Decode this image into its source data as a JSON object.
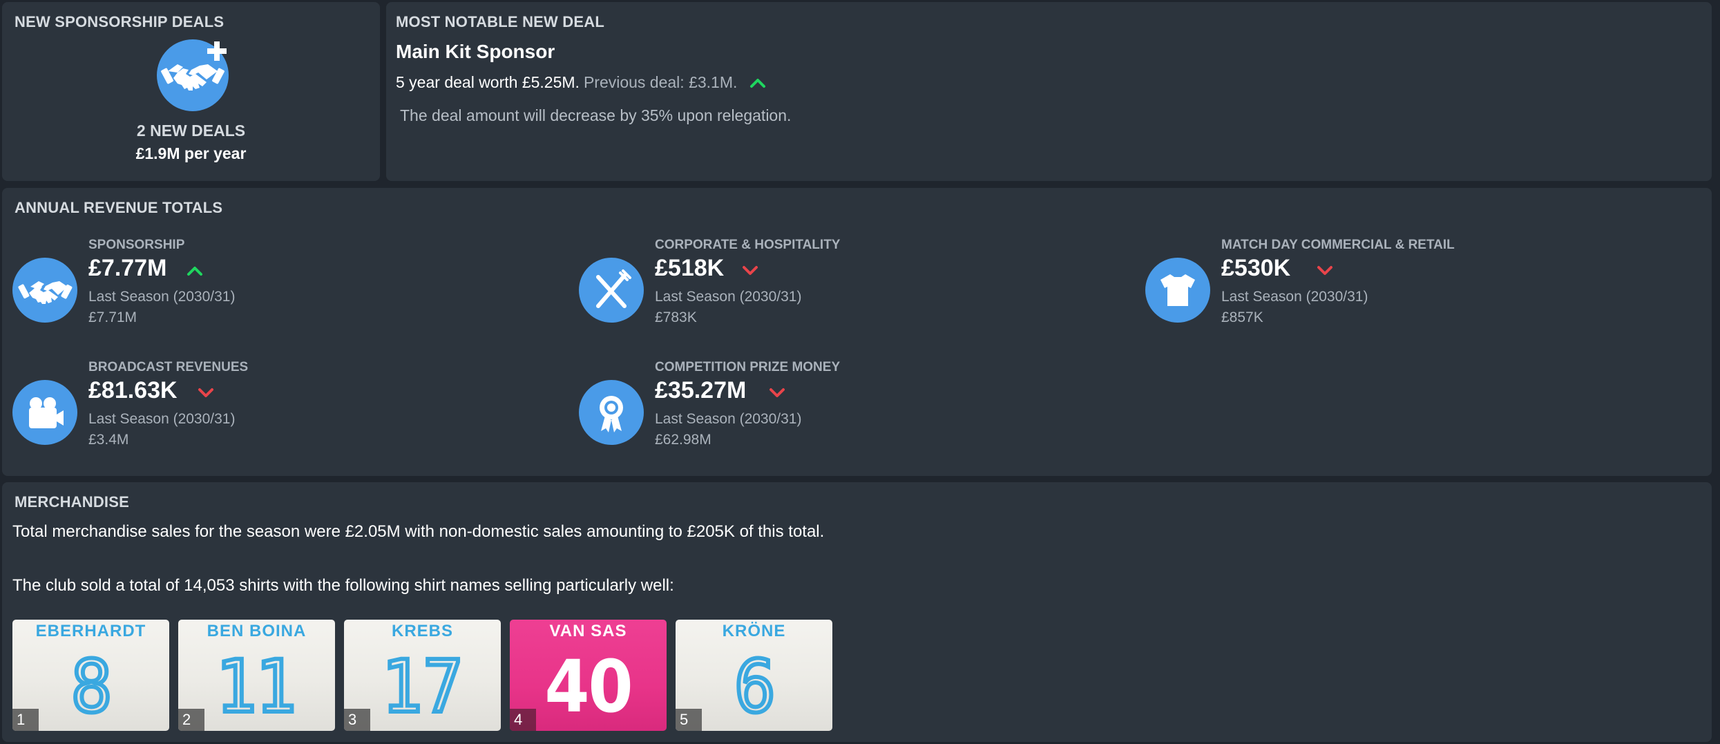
{
  "sponsorship_panel": {
    "title": "NEW SPONSORSHIP DEALS",
    "deals_count": "2 NEW DEALS",
    "per_year": "£1.9M per year"
  },
  "notable_panel": {
    "title": "MOST NOTABLE NEW DEAL",
    "deal_name": "Main Kit Sponsor",
    "deal_worth": "5 year deal worth £5.25M.",
    "previous_deal": "Previous deal: £3.1M.",
    "trend": "up",
    "relegation_note": "The deal amount will decrease by 35% upon relegation."
  },
  "revenue_panel": {
    "title": "ANNUAL REVENUE TOTALS",
    "items": [
      {
        "label": "SPONSORSHIP",
        "value": "£7.77M",
        "trend": "up",
        "last_season": "Last Season (2030/31)",
        "last_value": "£7.71M",
        "icon": "handshake-icon"
      },
      {
        "label": "CORPORATE & HOSPITALITY",
        "value": "£518K",
        "trend": "down",
        "last_season": "Last Season (2030/31)",
        "last_value": "£783K",
        "icon": "cutlery-icon"
      },
      {
        "label": "MATCH DAY COMMERCIAL & RETAIL",
        "value": "£530K",
        "trend": "down",
        "last_season": "Last Season (2030/31)",
        "last_value": "£857K",
        "icon": "shirt-icon"
      },
      {
        "label": "BROADCAST REVENUES",
        "value": "£81.63K",
        "trend": "down",
        "last_season": "Last Season (2030/31)",
        "last_value": "£3.4M",
        "icon": "video-camera-icon"
      },
      {
        "label": "COMPETITION PRIZE MONEY",
        "value": "£35.27M",
        "trend": "down",
        "last_season": "Last Season (2030/31)",
        "last_value": "£62.98M",
        "icon": "award-ribbon-icon"
      }
    ]
  },
  "merchandise_panel": {
    "title": "MERCHANDISE",
    "summary": "Total merchandise sales for the season were £2.05M with non-domestic sales amounting to £205K of this total.",
    "shirts_intro": "The club sold a total of 14,053 shirts with the following shirt names selling particularly well:",
    "shirts": [
      {
        "name": "EBERHARDT",
        "number": "8",
        "rank": "1",
        "style": "home"
      },
      {
        "name": "BEN BOINA",
        "number": "11",
        "rank": "2",
        "style": "home"
      },
      {
        "name": "KREBS",
        "number": "17",
        "rank": "3",
        "style": "home"
      },
      {
        "name": "VAN SAS",
        "number": "40",
        "rank": "4",
        "style": "pink"
      },
      {
        "name": "KRÖNE",
        "number": "6",
        "rank": "5",
        "style": "home"
      }
    ]
  },
  "colors": {
    "background": "#1f252d",
    "panel": "#2c343d",
    "accent_blue": "#4a9be8",
    "trend_up": "#1fd65f",
    "trend_down": "#e8444a",
    "shirt_blue": "#3aa8e0",
    "shirt_pink": "#e83489"
  }
}
